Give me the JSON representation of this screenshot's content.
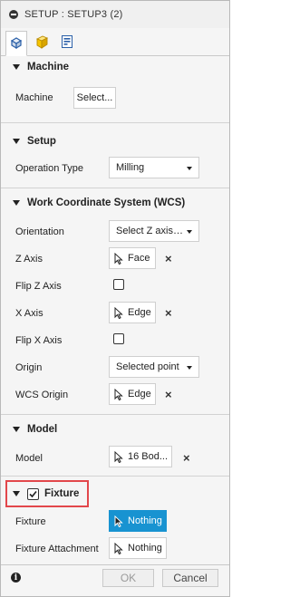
{
  "window": {
    "title": "SETUP : SETUP3 (2)"
  },
  "tabs": [
    {
      "name": "setup-tab-icon",
      "active": true
    },
    {
      "name": "stock-tab-icon",
      "active": false
    },
    {
      "name": "post-process-tab-icon",
      "active": false
    }
  ],
  "machine": {
    "header": "Machine",
    "label": "Machine",
    "button": "Select..."
  },
  "setup": {
    "header": "Setup",
    "operation_type_label": "Operation Type",
    "operation_type_value": "Milling"
  },
  "wcs": {
    "header": "Work Coordinate System (WCS)",
    "orientation_label": "Orientation",
    "orientation_value": "Select Z axis/plane & X axis",
    "z_axis_label": "Z Axis",
    "z_axis_value": "Face",
    "flip_z_label": "Flip Z Axis",
    "flip_z_checked": false,
    "x_axis_label": "X Axis",
    "x_axis_value": "Edge",
    "flip_x_label": "Flip X Axis",
    "flip_x_checked": false,
    "origin_label": "Origin",
    "origin_value": "Selected point",
    "wcs_origin_label": "WCS Origin",
    "wcs_origin_value": "Edge",
    "clear_glyph": "×"
  },
  "model": {
    "header": "Model",
    "label": "Model",
    "value": "16 Bod..."
  },
  "fixture": {
    "header": "Fixture",
    "enabled": true,
    "fixture_label": "Fixture",
    "fixture_value": "Nothing",
    "attachment_label": "Fixture Attachment",
    "attachment_value": "Nothing"
  },
  "footer": {
    "info_glyph": "i",
    "ok_label": "OK",
    "cancel_label": "Cancel"
  },
  "colors": {
    "highlight_outline": "#e2474b",
    "active_selection": "#1893d1"
  }
}
